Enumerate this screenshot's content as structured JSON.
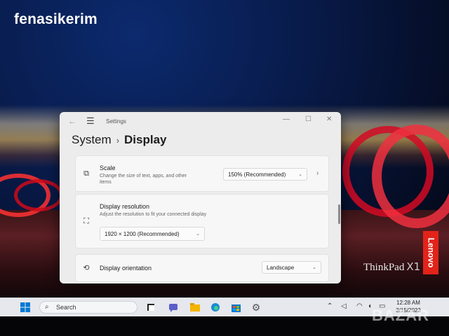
{
  "watermark": "fenasikerim",
  "watermark_bottom": "BAZAR",
  "brand": {
    "lenovo": "Lenovo",
    "thinkpad": "ThinkPad",
    "model": "X1"
  },
  "window": {
    "title": "Settings",
    "breadcrumb": {
      "parent": "System",
      "separator": "›",
      "current": "Display"
    },
    "controls": {
      "minimize": "—",
      "maximize": "☐",
      "close": "✕"
    }
  },
  "settings": {
    "scale": {
      "title": "Scale",
      "description_line1": "Change the size of text, apps, and other",
      "description_line2": "items",
      "value": "150% (Recommended)"
    },
    "resolution": {
      "title": "Display resolution",
      "description": "Adjust the resolution to fit your connected display",
      "value": "1920 × 1200 (Recommended)"
    },
    "orientation": {
      "title": "Display orientation",
      "value": "Landscape"
    }
  },
  "taskbar": {
    "search_label": "Search",
    "apps": [
      "start-icon",
      "search-icon",
      "task-view-icon",
      "chat-icon",
      "file-explorer-icon",
      "edge-icon",
      "store-icon",
      "settings-icon"
    ],
    "clock_time": "12:28 AM",
    "clock_date": "3/15/2023"
  },
  "colors": {
    "accent": "#0067c0",
    "lenovo_red": "#e2231a",
    "window_bg": "#ececec"
  }
}
